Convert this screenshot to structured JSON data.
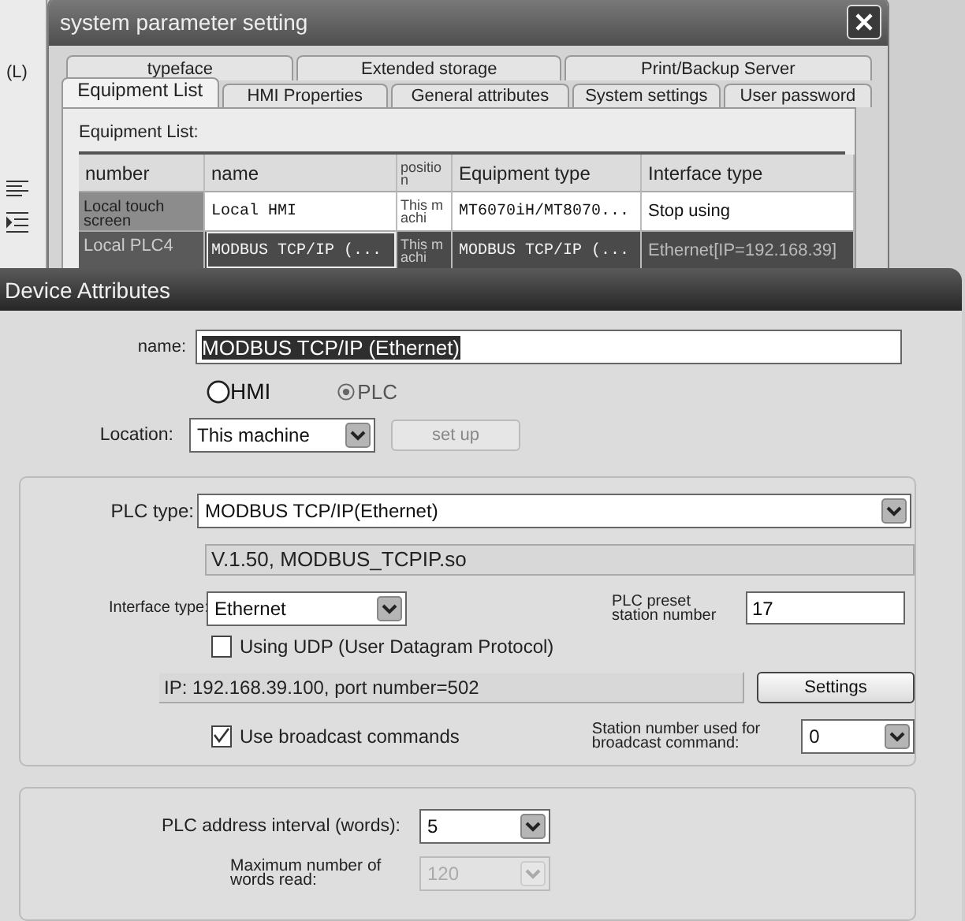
{
  "background_app": {
    "menu_text": "(L)"
  },
  "system_window": {
    "title": "system parameter setting",
    "tab_rows": [
      [
        {
          "label": "typeface",
          "selected": false
        },
        {
          "label": "Extended storage",
          "selected": false
        },
        {
          "label": "Print/Backup Server",
          "selected": false
        }
      ],
      [
        {
          "label": "Equipment List",
          "selected": true
        },
        {
          "label": "HMI Properties",
          "selected": false
        },
        {
          "label": "General attributes",
          "selected": false
        },
        {
          "label": "System settings",
          "selected": false
        },
        {
          "label": "User password",
          "selected": false
        }
      ]
    ],
    "list_label": "Equipment List:",
    "table": {
      "columns": [
        "number",
        "name",
        "position",
        "Equipment type",
        "Interface type"
      ],
      "rows": [
        {
          "cells": [
            "Local touch screen",
            "Local HMI",
            "This machi",
            "MT6070iH/MT8070...",
            "Stop using"
          ],
          "selected": false
        },
        {
          "cells": [
            "Local PLC4",
            "MODBUS TCP/IP (...",
            "This machi",
            "MODBUS TCP/IP (...",
            "Ethernet[IP=192.168.39]"
          ],
          "selected": true
        }
      ]
    }
  },
  "device_window": {
    "title": "Device Attributes",
    "name": {
      "label": "name:",
      "value": "MODBUS TCP/IP (Ethernet)",
      "text_selected": true
    },
    "device_kind": [
      {
        "label": "HMI",
        "selected": false
      },
      {
        "label": "PLC",
        "selected": true
      }
    ],
    "location": {
      "label": "Location:",
      "value": "This machine"
    },
    "setup_button": {
      "label": "set up",
      "disabled": true
    },
    "plc_group": {
      "plc_type": {
        "label": "PLC type:",
        "value": "MODBUS TCP/IP(Ethernet)"
      },
      "version": "V.1.50, MODBUS_TCPIP.so",
      "interface": {
        "label": "Interface type:",
        "value": "Ethernet"
      },
      "station": {
        "label": "PLC preset station number",
        "value": "17"
      },
      "udp": {
        "label": "Using UDP (User Datagram Protocol)",
        "checked": false
      },
      "ip": "IP: 192.168.39.100, port number=502",
      "settings_button": "Settings",
      "broadcast": {
        "label": "Use broadcast commands",
        "checked": true
      },
      "broadcast_station": {
        "label": "Station number used for broadcast command:",
        "value": "0"
      }
    },
    "address_group": {
      "interval": {
        "label": "PLC address interval (words):",
        "value": "5",
        "disabled": false
      },
      "max_read": {
        "label": "Maximum number of words read:",
        "value": "120",
        "disabled": true
      }
    }
  }
}
